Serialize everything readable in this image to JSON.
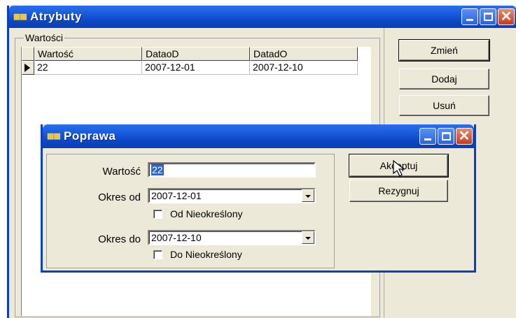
{
  "window": {
    "title": "Atrybuty",
    "icon": "app-icon"
  },
  "group": {
    "label": "Wartości"
  },
  "grid": {
    "columns": [
      "Wartość",
      "DataoD",
      "DatadO"
    ],
    "rows": [
      {
        "wartosc": "22",
        "od": "2007-12-01",
        "do": "2007-12-10"
      }
    ]
  },
  "buttons": {
    "zmien": "Zmień",
    "dodaj": "Dodaj",
    "usun": "Usuń"
  },
  "dialog": {
    "title": "Poprawa",
    "wartosc_label": "Wartość",
    "wartosc_value": "22",
    "okres_od_label": "Okres od",
    "okres_od_value": "2007-12-01",
    "od_nieokreslony": "Od Nieokreślony",
    "okres_do_label": "Okres do",
    "okres_do_value": "2007-12-10",
    "do_nieokreslony": "Do Nieokreślony",
    "akceptuj": "Akceptuj",
    "rezygnuj": "Rezygnuj"
  }
}
